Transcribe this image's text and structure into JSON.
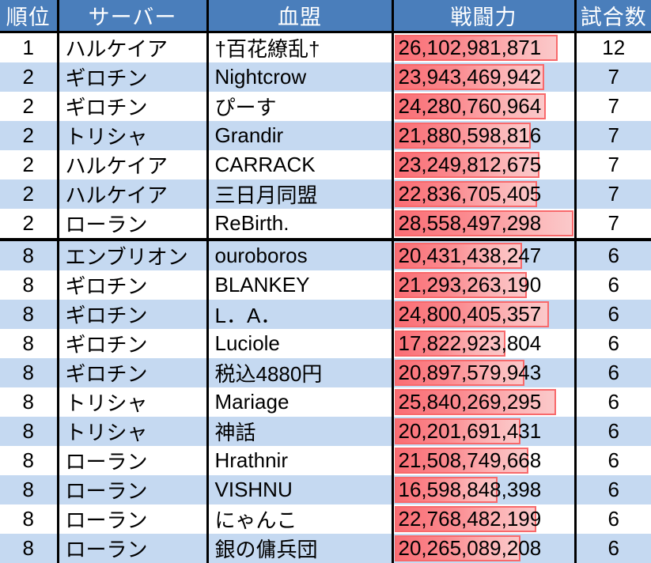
{
  "table": {
    "columns": [
      {
        "key": "rank",
        "label": "順位",
        "align": "center"
      },
      {
        "key": "server",
        "label": "サーバー",
        "align": "left"
      },
      {
        "key": "clan",
        "label": "血盟",
        "align": "left"
      },
      {
        "key": "power",
        "label": "戦闘力",
        "align": "left"
      },
      {
        "key": "matches",
        "label": "試合数",
        "align": "center"
      }
    ],
    "header_bg": "#4a7ebb",
    "header_fg": "#ffffff",
    "stripe_color": "#c5d9f1",
    "databar_fill": "#fa6d74",
    "databar_border": "#f8696b",
    "databar_max": 28558497298,
    "rows": [
      {
        "rank": "1",
        "server": "ハルケイア",
        "clan": "†百花繚乱†",
        "power": "26,102,981,871",
        "power_value": 26102981871,
        "matches": "12",
        "group_start": false
      },
      {
        "rank": "2",
        "server": "ギロチン",
        "clan": "Nightcrow",
        "power": "23,943,469,942",
        "power_value": 23943469942,
        "matches": "7",
        "group_start": false
      },
      {
        "rank": "2",
        "server": "ギロチン",
        "clan": "ぴーす",
        "power": "24,280,760,964",
        "power_value": 24280760964,
        "matches": "7",
        "group_start": false
      },
      {
        "rank": "2",
        "server": "トリシャ",
        "clan": "Grandir",
        "power": "21,880,598,816",
        "power_value": 21880598816,
        "matches": "7",
        "group_start": false
      },
      {
        "rank": "2",
        "server": "ハルケイア",
        "clan": "CARRACK",
        "power": "23,249,812,675",
        "power_value": 23249812675,
        "matches": "7",
        "group_start": false
      },
      {
        "rank": "2",
        "server": "ハルケイア",
        "clan": "三日月同盟",
        "power": "22,836,705,405",
        "power_value": 22836705405,
        "matches": "7",
        "group_start": false
      },
      {
        "rank": "2",
        "server": "ローラン",
        "clan": "ReBirth.",
        "power": "28,558,497,298",
        "power_value": 28558497298,
        "matches": "7",
        "group_start": false
      },
      {
        "rank": "8",
        "server": "エンブリオン",
        "clan": "ouroboros",
        "power": "20,431,438,247",
        "power_value": 20431438247,
        "matches": "6",
        "group_start": true
      },
      {
        "rank": "8",
        "server": "ギロチン",
        "clan": "BLANKEY",
        "power": "21,293,263,190",
        "power_value": 21293263190,
        "matches": "6",
        "group_start": false
      },
      {
        "rank": "8",
        "server": "ギロチン",
        "clan": "L．A．",
        "power": "24,800,405,357",
        "power_value": 24800405357,
        "matches": "6",
        "group_start": false
      },
      {
        "rank": "8",
        "server": "ギロチン",
        "clan": "Luciole",
        "power": "17,822,923,804",
        "power_value": 17822923804,
        "matches": "6",
        "group_start": false
      },
      {
        "rank": "8",
        "server": "ギロチン",
        "clan": "税込4880円",
        "power": "20,897,579,943",
        "power_value": 20897579943,
        "matches": "6",
        "group_start": false
      },
      {
        "rank": "8",
        "server": "トリシャ",
        "clan": "Mariage",
        "power": "25,840,269,295",
        "power_value": 25840269295,
        "matches": "6",
        "group_start": false
      },
      {
        "rank": "8",
        "server": "トリシャ",
        "clan": "神話",
        "power": "20,201,691,431",
        "power_value": 20201691431,
        "matches": "6",
        "group_start": false
      },
      {
        "rank": "8",
        "server": "ローラン",
        "clan": "Hrathnir",
        "power": "21,508,749,668",
        "power_value": 21508749668,
        "matches": "6",
        "group_start": false
      },
      {
        "rank": "8",
        "server": "ローラン",
        "clan": "VISHNU",
        "power": "16,598,848,398",
        "power_value": 16598848398,
        "matches": "6",
        "group_start": false
      },
      {
        "rank": "8",
        "server": "ローラン",
        "clan": "にゃんこ",
        "power": "22,768,482,199",
        "power_value": 22768482199,
        "matches": "6",
        "group_start": false
      },
      {
        "rank": "8",
        "server": "ローラン",
        "clan": "銀の傭兵団",
        "power": "20,265,089,208",
        "power_value": 20265089208,
        "matches": "6",
        "group_start": false
      }
    ]
  }
}
